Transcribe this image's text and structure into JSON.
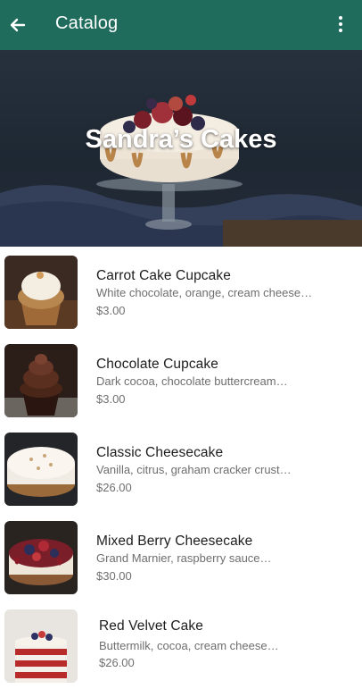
{
  "appbar": {
    "title": "Catalog",
    "back_icon": "arrow-left-icon",
    "menu_icon": "more-vertical-icon",
    "color": "#1f6b5c"
  },
  "hero": {
    "title": "Sandra’s Cakes"
  },
  "products": [
    {
      "name": "Carrot Cake Cupcake",
      "description": "White chocolate, orange, cream cheese…",
      "price": "$3.00"
    },
    {
      "name": "Chocolate Cupcake",
      "description": "Dark cocoa, chocolate buttercream…",
      "price": "$3.00"
    },
    {
      "name": "Classic Cheesecake",
      "description": "Vanilla, citrus, graham cracker crust…",
      "price": "$26.00"
    },
    {
      "name": "Mixed Berry Cheesecake",
      "description": "Grand Marnier, raspberry sauce…",
      "price": "$30.00"
    },
    {
      "name": "Red Velvet Cake",
      "description": "Buttermilk, cocoa, cream cheese…",
      "price": "$26.00"
    }
  ]
}
